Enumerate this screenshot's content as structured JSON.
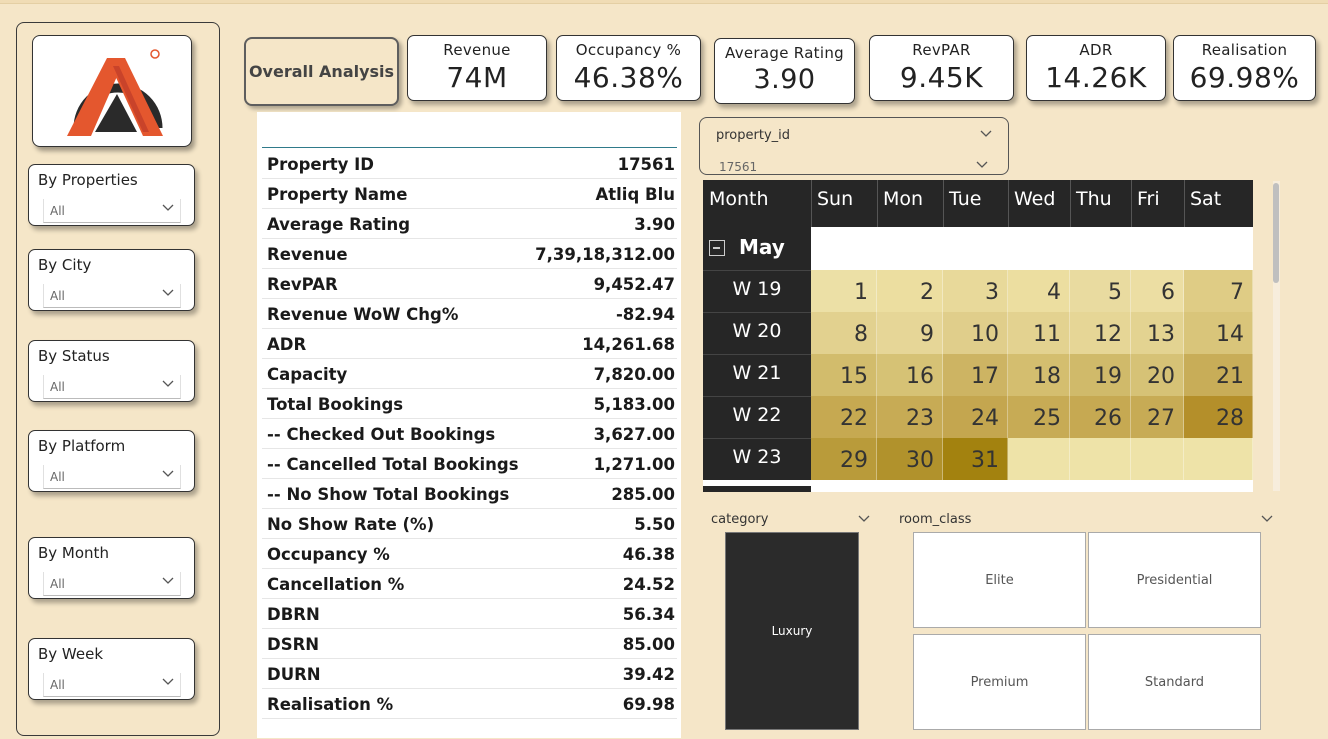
{
  "logo": {
    "name": "atliq-logo-icon",
    "colors": {
      "primary": "#e4572e",
      "dark": "#2a2a2a",
      "stripe": "#c9432a"
    }
  },
  "sidebar": {
    "slicers": [
      {
        "title": "By Properties",
        "value": "All"
      },
      {
        "title": "By City",
        "value": "All"
      },
      {
        "title": "By Status",
        "value": "All"
      },
      {
        "title": "By Platform",
        "value": "All"
      },
      {
        "title": "By Month",
        "value": "All"
      },
      {
        "title": "By Week",
        "value": "All"
      }
    ]
  },
  "overall_button": "Overall Analysis",
  "kpis": [
    {
      "label": "Revenue",
      "value": "74M"
    },
    {
      "label": "Occupancy %",
      "value": "46.38%"
    },
    {
      "label": "Average Rating",
      "value": "3.90"
    },
    {
      "label": "RevPAR",
      "value": "9.45K"
    },
    {
      "label": "ADR",
      "value": "14.26K"
    },
    {
      "label": "Realisation",
      "value": "69.98%"
    }
  ],
  "details_table": [
    {
      "key": "Property ID",
      "value": "17561"
    },
    {
      "key": "Property Name",
      "value": "Atliq Blu"
    },
    {
      "key": "Average Rating",
      "value": "3.90"
    },
    {
      "key": "Revenue",
      "value": "7,39,18,312.00"
    },
    {
      "key": "RevPAR",
      "value": "9,452.47"
    },
    {
      "key": "Revenue WoW Chg%",
      "value": "-82.94"
    },
    {
      "key": "ADR",
      "value": "14,261.68"
    },
    {
      "key": "Capacity",
      "value": "7,820.00"
    },
    {
      "key": "Total Bookings",
      "value": "5,183.00"
    },
    {
      "key": "-- Checked Out Bookings",
      "value": "3,627.00"
    },
    {
      "key": "-- Cancelled Total Bookings",
      "value": "1,271.00"
    },
    {
      "key": "-- No Show Total Bookings",
      "value": "285.00"
    },
    {
      "key": "No Show Rate (%)",
      "value": "5.50"
    },
    {
      "key": "Occupancy %",
      "value": "46.38"
    },
    {
      "key": "Cancellation %",
      "value": "24.52"
    },
    {
      "key": "DBRN",
      "value": "56.34"
    },
    {
      "key": "DSRN",
      "value": "85.00"
    },
    {
      "key": "DURN",
      "value": "39.42"
    },
    {
      "key": "Realisation %",
      "value": "69.98"
    }
  ],
  "property_slicer": {
    "title": "property_id",
    "value": "17561"
  },
  "calendar": {
    "headers": [
      "Month",
      "Sun",
      "Mon",
      "Tue",
      "Wed",
      "Thu",
      "Fri",
      "Sat"
    ],
    "month": "May",
    "weeks": [
      {
        "label": "W 19",
        "days": [
          "1",
          "2",
          "3",
          "4",
          "5",
          "6",
          "7"
        ]
      },
      {
        "label": "W 20",
        "days": [
          "8",
          "9",
          "10",
          "11",
          "12",
          "13",
          "14"
        ]
      },
      {
        "label": "W 21",
        "days": [
          "15",
          "16",
          "17",
          "18",
          "19",
          "20",
          "21"
        ]
      },
      {
        "label": "W 22",
        "days": [
          "22",
          "23",
          "24",
          "25",
          "26",
          "27",
          "28"
        ]
      },
      {
        "label": "W 23",
        "days": [
          "29",
          "30",
          "31",
          "",
          "",
          "",
          ""
        ]
      }
    ],
    "shades": [
      [
        "#ece0a6",
        "#ecdea0",
        "#e8d99a",
        "#ecdea0",
        "#e9dba0",
        "#ecdea3",
        "#dfcc85"
      ],
      [
        "#e2d18f",
        "#e6d697",
        "#e0ce8b",
        "#e3d290",
        "#e6d696",
        "#e3d391",
        "#d9c57a"
      ],
      [
        "#d2bc6c",
        "#d6c275",
        "#cdb463",
        "#d4be6f",
        "#d0ba6a",
        "#d6c276",
        "#c8ad58"
      ],
      [
        "#c6a951",
        "#c7ab55",
        "#c4a64f",
        "#c7ab55",
        "#c6a952",
        "#c7ab55",
        "#b48f2a"
      ],
      [
        "#b99b3a",
        "#b1922c",
        "#a3820f",
        "#eee3a8",
        "#eee3a8",
        "#eee3a8",
        "#eee3a8"
      ]
    ]
  },
  "category_slicer": {
    "title": "category",
    "tiles": [
      "Luxury"
    ]
  },
  "room_class_slicer": {
    "title": "room_class",
    "tiles": [
      "Elite",
      "Presidential",
      "Premium",
      "Standard"
    ]
  }
}
